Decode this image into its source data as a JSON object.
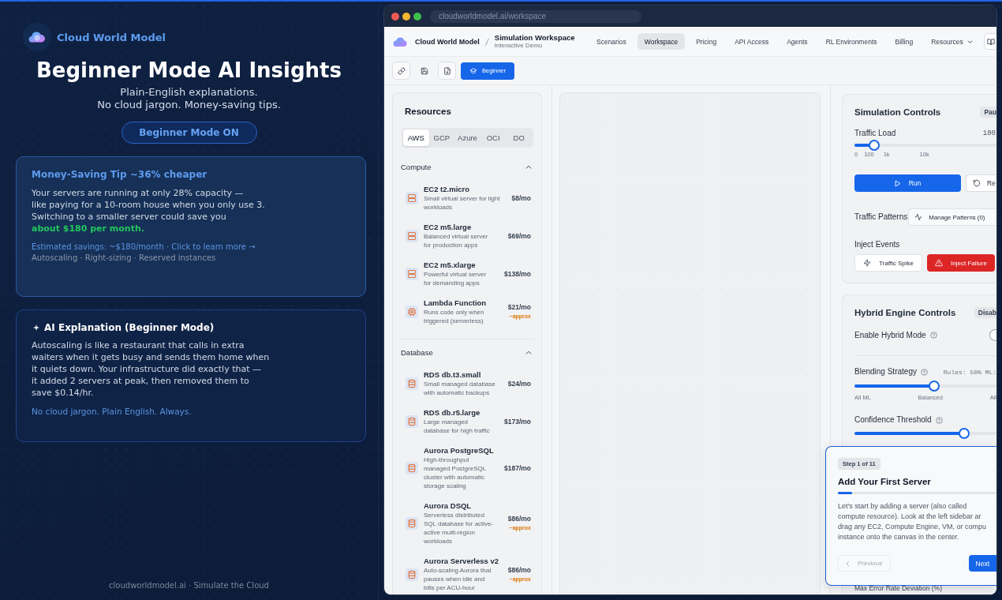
{
  "promo": {
    "brand": "Cloud World Model",
    "headline": "Beginner Mode AI Insights",
    "subtitle": "Plain-English explanations.\nNo cloud jargon. Money-saving tips.",
    "mode_button": "Beginner Mode ON",
    "tip_card": {
      "title": "Money-Saving Tip ~36% cheaper",
      "body": "Your servers are running at only 28% capacity —\nlike paying for a 10-room house when you only use 3.\nSwitching to a smaller server could save you\n**about $180 per month.**",
      "savings_link": "Estimated savings: ~$180/month · Click to learn more →",
      "topics": "Autoscaling · Right-sizing · Reserved instances"
    },
    "explanation_card": {
      "title": "AI Explanation (Beginner Mode)",
      "body": "Autoscaling is like a restaurant that calls in extra\nwaiters when it gets busy and sends them home when\nit quiets down. Your infrastructure did exactly that —\nit added 2 servers at peak, then removed them to\nsave $0.14/hr.",
      "tagline": "No cloud jargon. Plain English. Always."
    },
    "footer": "cloudworldmodel.ai · Simulate the Cloud"
  },
  "browser": {
    "url": "cloudworldmodel.ai/workspace"
  },
  "app": {
    "brand": "Cloud World Model",
    "page_title": "Simulation Workspace",
    "page_subtitle": "Interactive Demo",
    "nav": [
      {
        "label": "Scenarios",
        "selected": false,
        "kind": "link"
      },
      {
        "label": "Workspace",
        "selected": true,
        "kind": "link"
      },
      {
        "label": "Pricing",
        "selected": false,
        "kind": "link"
      },
      {
        "label": "API Access",
        "selected": false,
        "kind": "link"
      },
      {
        "label": "Agents",
        "selected": false,
        "kind": "link"
      },
      {
        "label": "RL Environments",
        "selected": false,
        "kind": "link"
      },
      {
        "label": "Billing",
        "selected": false,
        "kind": "link"
      },
      {
        "label": "Resources",
        "selected": false,
        "kind": "menu"
      }
    ],
    "toolbar": {
      "mode_button": "Beginner"
    },
    "sidebar": {
      "title": "Resources",
      "providers": [
        {
          "label": "AWS",
          "selected": true
        },
        {
          "label": "GCP",
          "selected": false
        },
        {
          "label": "Azure",
          "selected": false
        },
        {
          "label": "OCI",
          "selected": false
        },
        {
          "label": "DO",
          "selected": false
        }
      ],
      "sections": [
        {
          "title": "Compute",
          "expanded": true,
          "items": [
            {
              "kind": "server",
              "name": "EC2 t2.micro",
              "description": "Small virtual server for light\nworkloads",
              "price": "$8/mo"
            },
            {
              "kind": "server",
              "name": "EC2 m5.large",
              "description": "Balanced virtual server\nfor production apps",
              "price": "$69/mo"
            },
            {
              "kind": "server",
              "name": "EC2 m5.xlarge",
              "description": "Powerful virtual server\nfor demanding apps",
              "price": "$138/mo"
            },
            {
              "kind": "function",
              "name": "Lambda Function",
              "description": "Runs code only when\ntriggered (serverless)",
              "price": "$21/mo",
              "note": "~approx"
            }
          ]
        },
        {
          "title": "Database",
          "expanded": true,
          "items": [
            {
              "kind": "database",
              "name": "RDS db.t3.small",
              "description": "Small managed database\nwith automatic backups",
              "price": "$24/mo"
            },
            {
              "kind": "database",
              "name": "RDS db.r5.large",
              "description": "Large managed\ndatabase for high traffic",
              "price": "$173/mo"
            },
            {
              "kind": "database",
              "name": "Aurora PostgreSQL",
              "description": "High-throughput\nmanaged PostgreSQL\ncluster with automatic\nstorage scaling",
              "price": "$187/mo"
            },
            {
              "kind": "database",
              "name": "Aurora DSQL",
              "description": "Serverless distributed\nSQL database for active-\nactive multi-region\nworkloads",
              "price": "$86/mo",
              "note": "~approx"
            },
            {
              "kind": "database",
              "name": "Aurora Serverless v2",
              "description": "Auto-scaling Aurora that\npauses when idle and\nbills per ACU-hour",
              "price": "$86/mo",
              "note": "~approx"
            }
          ]
        }
      ]
    },
    "controls": {
      "title": "Simulation Controls",
      "status": "Pau",
      "traffic_load": {
        "label": "Traffic Load",
        "reading": "100",
        "level": 0.14,
        "ticks": [
          "0",
          "100",
          "1k",
          "10k"
        ]
      },
      "run_button": "Run",
      "reset_button": "Re",
      "patterns_label": "Traffic Patterns",
      "patterns_button": "Manage Patterns (0)",
      "events_label": "Inject Events",
      "event_buttons": [
        {
          "kind": "spike",
          "label": "Traffic Spike"
        },
        {
          "kind": "failure",
          "label": "Inject Failure"
        }
      ]
    },
    "hybrid": {
      "title": "Hybrid Engine Controls",
      "status": "Disab",
      "enable_label": "Enable Hybrid Mode",
      "enabled": false,
      "blending": {
        "label": "Blending Strategy",
        "reading": "Rules: 50% ML:",
        "level": 0.56,
        "scale": [
          "All ML",
          "Balanced",
          "All"
        ]
      },
      "confidence": {
        "label": "Confidence Threshold",
        "level": 0.77
      },
      "max_error_label": "Max Error Rate Deviation (%)"
    },
    "tour": {
      "step": "Step 1 of 11",
      "title": "Add Your First Server",
      "level": 0.09,
      "text": "Let's start by adding a server (also called\ncompute resource). Look at the left sidebar ar\ndrag any EC2, Compute Engine, VM, or compu\ninstance onto the canvas in the center.",
      "previous": {
        "label": "Previous",
        "disabled": true
      },
      "next": "Next"
    }
  }
}
